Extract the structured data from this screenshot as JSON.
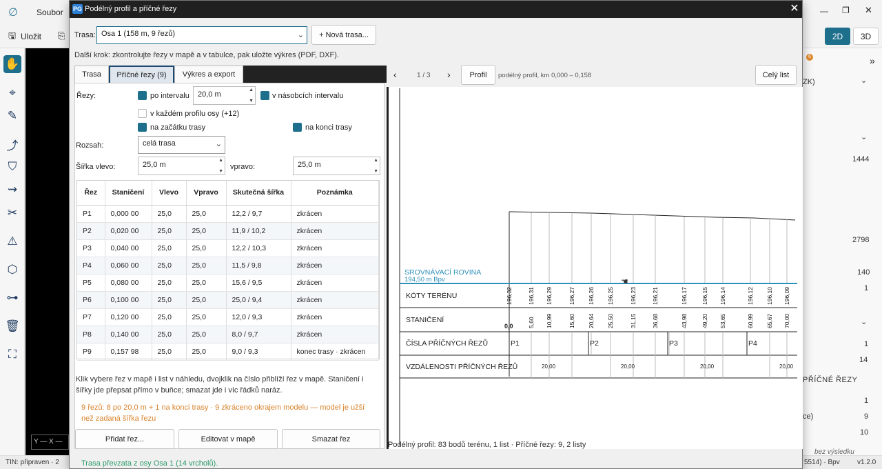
{
  "app": {
    "menu_file": "Soubor",
    "save_label": "Uložit",
    "mode_2d": "2D",
    "mode_3d": "3D",
    "status_left": "TIN: připraven · 2",
    "status_coords": "Y —    X —",
    "status_right_crs": "5514) · Bpv",
    "status_version": "v1.2.0",
    "right_panel": {
      "badge": "6",
      "item_zk": "ZK)",
      "v1": "1444",
      "v2": "2798",
      "v3": "140",
      "v4": "1",
      "v5": "1",
      "v6": "14",
      "cross_header": "PŘÍČNÉ ŘEZY",
      "v7": "1",
      "v8_label": "ce)",
      "v8": "9",
      "v9": "10",
      "footer_link": "bez výsledku"
    }
  },
  "dialog": {
    "title": "Podélný profil a příčné řezy",
    "logo": "PG",
    "route_label": "Trasa:",
    "route_value": "Osa 1  (158 m, 9 řezů)",
    "new_route_button": "+ Nová trasa...",
    "next_step": "Další krok: zkontrolujte řezy v mapě a v tabulce, pak uložte výkres (PDF, DXF).",
    "tabs": [
      "Trasa",
      "Příčné řezy (9)",
      "Výkres a export"
    ],
    "sections_label": "Řezy:",
    "opt_interval": "po intervalu",
    "interval_value": "20,0 m",
    "opt_multiples": "v násobcích intervalu",
    "opt_each_vertex": "v každém profilu osy (+12)",
    "opt_start": "na začátku trasy",
    "opt_end": "na konci trasy",
    "range_label": "Rozsah:",
    "range_value": "celá trasa",
    "width_left_label": "Šířka vlevo:",
    "width_left_value": "25,0 m",
    "width_right_label": "vpravo:",
    "width_right_value": "25,0 m",
    "table": {
      "headers": [
        "Řez",
        "Staničení",
        "Vlevo",
        "Vpravo",
        "Skutečná šířka",
        "Poznámka"
      ],
      "rows": [
        [
          "P1",
          "0,000 00",
          "25,0",
          "25,0",
          "12,2 / 9,7",
          "zkrácen"
        ],
        [
          "P2",
          "0,020 00",
          "25,0",
          "25,0",
          "11,9 / 10,2",
          "zkrácen"
        ],
        [
          "P3",
          "0,040 00",
          "25,0",
          "25,0",
          "12,2 / 10,3",
          "zkrácen"
        ],
        [
          "P4",
          "0,060 00",
          "25,0",
          "25,0",
          "11,5 / 9,8",
          "zkrácen"
        ],
        [
          "P5",
          "0,080 00",
          "25,0",
          "25,0",
          "15,6 / 9,5",
          "zkrácen"
        ],
        [
          "P6",
          "0,100 00",
          "25,0",
          "25,0",
          "25,0 / 9,4",
          "zkrácen"
        ],
        [
          "P7",
          "0,120 00",
          "25,0",
          "25,0",
          "12,0 / 9,3",
          "zkrácen"
        ],
        [
          "P8",
          "0,140 00",
          "25,0",
          "25,0",
          "8,0 / 9,7",
          "zkrácen"
        ],
        [
          "P9",
          "0,157 98",
          "25,0",
          "25,0",
          "9,0 / 9,3",
          "konec trasy · zkrácen"
        ]
      ]
    },
    "help_text": "Klik vybere řez v mapě i list v náhledu, dvojklik na číslo přiblíží řez v mapě. Staničení i šířky jde přepsat přímo v buňce; smazat jde i víc řádků naráz.",
    "warning_text": "9 řezů: 8 po 20,0 m + 1 na konci trasy · 9 zkráceno okrajem modelu — model je užší než zadaná šířka řezu",
    "add_button": "Přidat řez...",
    "edit_button": "Editovat v mapě",
    "delete_button": "Smazat řez",
    "status_text": "Trasa převzata z osy Osa 1 (14 vrcholů).",
    "preview": {
      "page_indicator": "1 / 3",
      "profile_button": "Profil",
      "profile_caption": "podélný profil, km 0,000 – 0,158",
      "full_sheet_button": "Celý list",
      "datum_label": "SROVNÁVACÍ ROVINA",
      "datum_value": "194,50 m Bpv",
      "band_terrain": "KÓTY TERÉNU",
      "band_chainage": "STANIČENÍ",
      "band_sections": "ČÍSLA PŘÍČNÝCH ŘEZŮ",
      "band_distances": "VZDÁLENOSTI PŘÍČNÝCH ŘEZŮ",
      "chainage_start": "0,0",
      "terrain_values": [
        "196,32",
        "196,31",
        "196,29",
        "196,27",
        "196,26",
        "196,25",
        "196,23",
        "196,21",
        "196,17",
        "196,15",
        "196,14",
        "196,12",
        "196,10",
        "196,09"
      ],
      "chainage_values": [
        "5,60",
        "10,99",
        "15,60",
        "20,64",
        "25,50",
        "31,15",
        "36,68",
        "43,98",
        "49,20",
        "53,65",
        "60,99",
        "65,67",
        "70,00"
      ],
      "section_labels": [
        "P1",
        "P2",
        "P3",
        "P4"
      ],
      "distance_values": [
        "20,00",
        "20,00",
        "20,00",
        "20,00"
      ],
      "footer": "Podélný profil: 83 bodů terénu, 1 list · Příčné řezy: 9, 2 listy"
    }
  }
}
